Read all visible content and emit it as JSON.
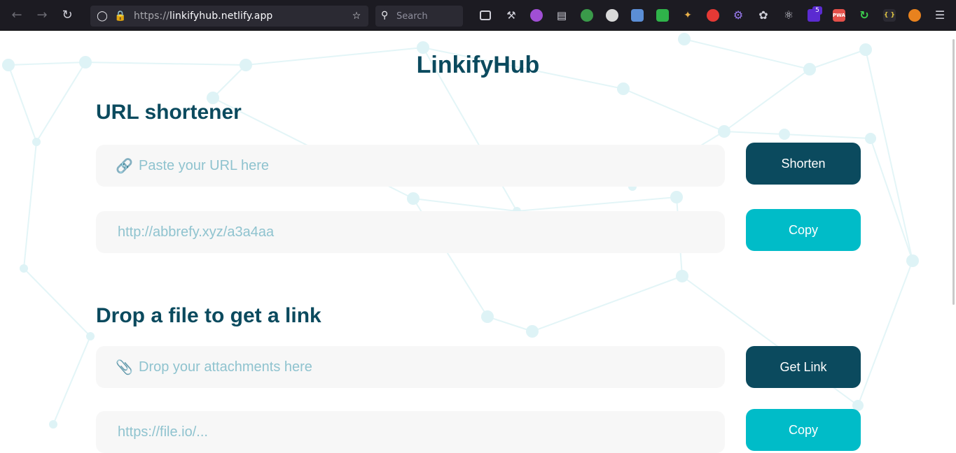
{
  "browser": {
    "url_prefix": "https://",
    "url_host": "linkifyhub.netlify.app",
    "search_placeholder": "Search",
    "extension_badge": "5",
    "pwa_label": "PWA",
    "json_label": "{ }"
  },
  "app": {
    "title": "LinkifyHub"
  },
  "shortener": {
    "title": "URL shortener",
    "input_placeholder": "Paste your URL here",
    "shorten_label": "Shorten",
    "result_value": "http://abbrefy.xyz/a3a4aa",
    "copy_label": "Copy"
  },
  "file_drop": {
    "title": "Drop a file to get a link",
    "input_placeholder": "Drop your attachments here",
    "get_link_label": "Get Link",
    "result_value": "https://file.io/...",
    "copy_label": "Copy"
  },
  "colors": {
    "brand_dark": "#0b4a5e",
    "brand_accent": "#00bcc8",
    "field_bg": "#f7f7f7",
    "placeholder_text": "#8fc3cf"
  },
  "icons": {
    "url_field": "link-icon",
    "file_field": "paperclip-icon"
  }
}
